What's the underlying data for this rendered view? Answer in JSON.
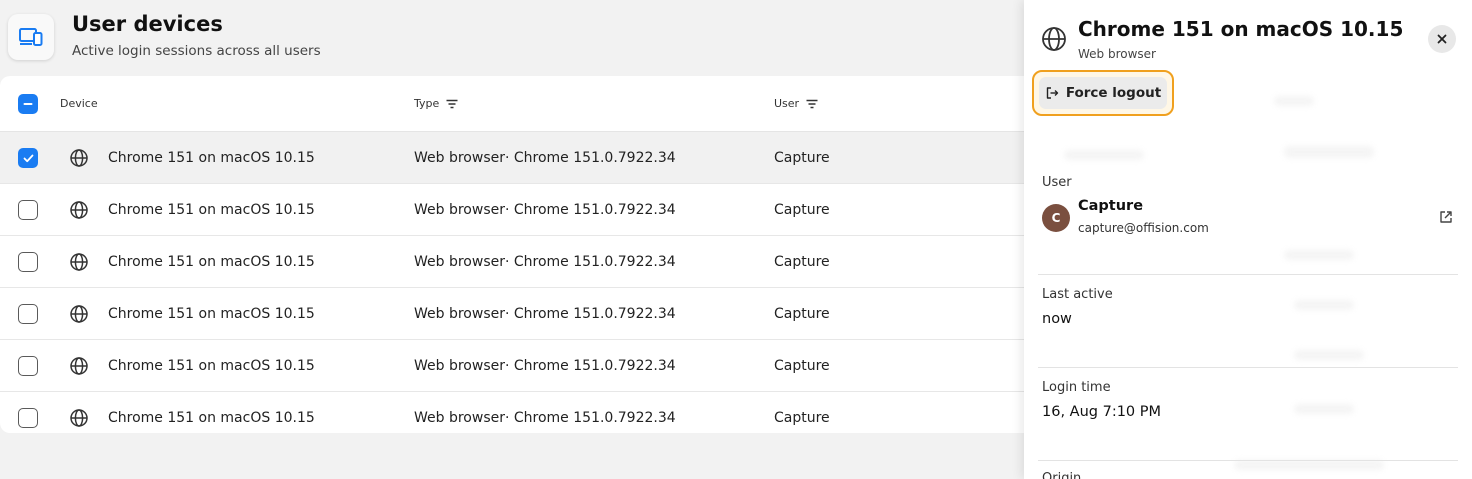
{
  "header": {
    "title": "User devices",
    "subtitle": "Active login sessions across all users",
    "icon": "devices-icon"
  },
  "table": {
    "columns": {
      "device": "Device",
      "type": "Type",
      "user": "User"
    },
    "rows": [
      {
        "device": "Chrome 151 on macOS 10.15",
        "type": "Web browser· Chrome 151.0.7922.34",
        "user": "Capture",
        "checked": true
      },
      {
        "device": "Chrome 151 on macOS 10.15",
        "type": "Web browser· Chrome 151.0.7922.34",
        "user": "Capture",
        "checked": false
      },
      {
        "device": "Chrome 151 on macOS 10.15",
        "type": "Web browser· Chrome 151.0.7922.34",
        "user": "Capture",
        "checked": false
      },
      {
        "device": "Chrome 151 on macOS 10.15",
        "type": "Web browser· Chrome 151.0.7922.34",
        "user": "Capture",
        "checked": false
      },
      {
        "device": "Chrome 151 on macOS 10.15",
        "type": "Web browser· Chrome 151.0.7922.34",
        "user": "Capture",
        "checked": false
      },
      {
        "device": "Chrome 151 on macOS 10.15",
        "type": "Web browser· Chrome 151.0.7922.34",
        "user": "Capture",
        "checked": false
      }
    ]
  },
  "panel": {
    "title": "Chrome 151 on macOS 10.15",
    "subtitle": "Web browser",
    "force_logout_label": "Force logout",
    "user_label": "User",
    "user_name": "Capture",
    "user_initial": "C",
    "user_email": "capture@offision.com",
    "last_active_label": "Last active",
    "last_active_value": "now",
    "login_time_label": "Login time",
    "login_time_value": "16, Aug 7:10 PM",
    "origin_label": "Origin"
  },
  "colors": {
    "accent": "#1a7cf2",
    "highlight": "#f0a01e",
    "avatar": "#7a4f3f"
  }
}
